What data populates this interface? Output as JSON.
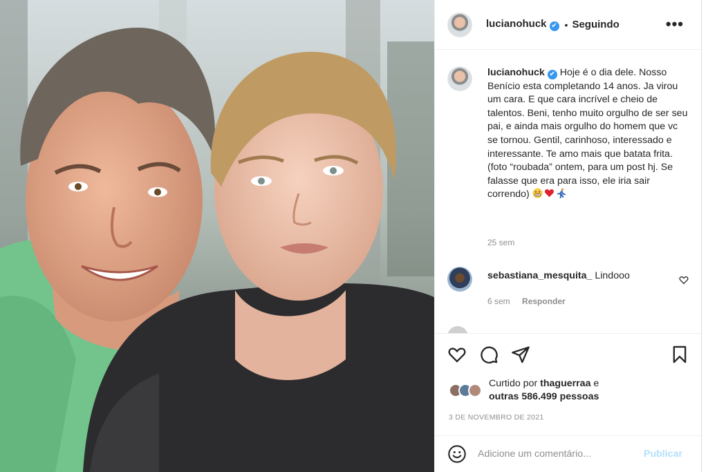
{
  "post": {
    "author": "lucianohuck",
    "verified_mark": "✔",
    "separator": "•",
    "follow_status": "Seguindo",
    "more_label": "•••",
    "caption_lines": [
      "Hoje é o dia dele. Nosso",
      "Benício esta completando 14 anos. Ja",
      "virou um cara. E que cara incrível e cheio",
      "de talentos. Beni, tenho muito orgulho",
      "de ser seu pai, e ainda mais orgulho do",
      "homem que vc se tornou. Gentil,",
      "carinhoso, interessado e interessante. Te",
      "amo mais que batata frita. (foto",
      "“roubada” ontem, para um post hj. Se",
      "falasse que era para isso, ele iria sair",
      "correndo)"
    ],
    "caption_emojis": [
      "grimacing-face",
      "red-heart",
      "person-running"
    ],
    "caption_time": "25 sem"
  },
  "comment": {
    "username": "sebastiana_mesquita_",
    "text": "Lindooo",
    "time": "6 sem",
    "reply_label": "Responder"
  },
  "likes": {
    "prefix": "Curtido por",
    "user": "thaguerraa",
    "suffix": "e",
    "others_prefix": "outras",
    "count": "586.499",
    "others_suffix": "pessoas"
  },
  "date": "3 DE NOVEMBRO DE 2021",
  "comment_box": {
    "placeholder": "Adicione um comentário...",
    "publish_label": "Publicar"
  },
  "colors": {
    "accent_blue": "#3897f0",
    "publish_disabled": "#b2dffc",
    "muted_text": "#8e8e8e",
    "heart_red": "#ed4956"
  },
  "icons": [
    "more-options-icon",
    "heart-icon",
    "comment-icon",
    "share-icon",
    "bookmark-icon",
    "emoji-icon",
    "verified-badge-icon"
  ]
}
